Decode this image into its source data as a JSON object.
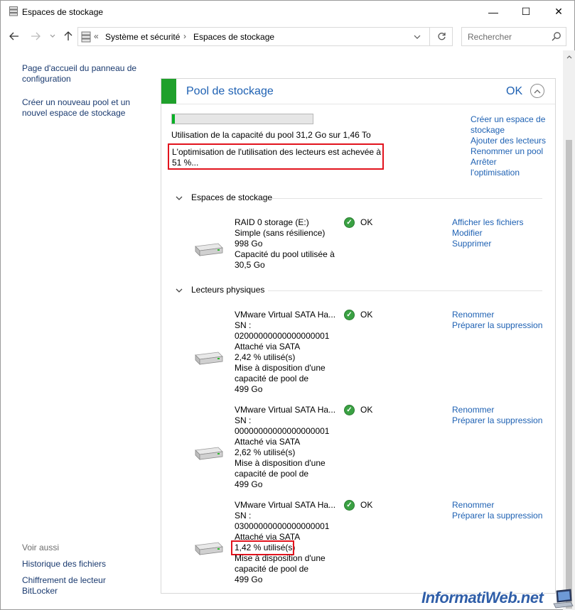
{
  "window": {
    "title": "Espaces de stockage",
    "min_glyph": "—",
    "max_glyph": "☐",
    "close_glyph": "✕"
  },
  "nav": {
    "breadcrumb_prefix": "«",
    "crumbs": [
      "Système et sécurité",
      "Espaces de stockage"
    ],
    "crumb_separator": "›",
    "search_placeholder": "Rechercher"
  },
  "left_pane": {
    "links": [
      "Page d'accueil du panneau de configuration",
      "Créer un nouveau pool et un nouvel espace de stockage"
    ],
    "see_also_label": "Voir aussi",
    "see_also_links": [
      "Historique des fichiers",
      "Chiffrement de lecteur BitLocker"
    ]
  },
  "pool": {
    "title": "Pool de stockage",
    "status": "OK",
    "capacity_used_fraction": 0.021,
    "capacity_usage": "Utilisation de la capacité du pool 31,2 Go sur 1,46 To",
    "optimization_status": "L'optimisation de l'utilisation des lecteurs est achevée à 51 %...",
    "actions": [
      "Créer un espace de stockage",
      "Ajouter des lecteurs",
      "Renommer un pool",
      "Arrêter l'optimisation"
    ]
  },
  "storage_spaces": {
    "heading": "Espaces de stockage",
    "items": [
      {
        "lines": [
          "RAID 0 storage (E:)",
          "Simple (sans résilience)",
          "998 Go",
          "Capacité du pool utilisée à",
          "30,5 Go"
        ],
        "status": "OK",
        "actions": [
          "Afficher les fichiers",
          "Modifier",
          "Supprimer"
        ]
      }
    ]
  },
  "physical_drives": {
    "heading": "Lecteurs physiques",
    "items": [
      {
        "lines": [
          "VMware Virtual SATA Ha...",
          "SN :",
          "02000000000000000001",
          "Attaché via SATA",
          "2,42 % utilisé(s)",
          "Mise à disposition d'une",
          "capacité de pool de",
          "499 Go"
        ],
        "status": "OK",
        "actions": [
          "Renommer",
          "Préparer la suppression"
        ]
      },
      {
        "lines": [
          "VMware Virtual SATA Ha...",
          "SN :",
          "00000000000000000001",
          "Attaché via SATA",
          "2,62 % utilisé(s)",
          "Mise à disposition d'une",
          "capacité de pool de",
          "499 Go"
        ],
        "status": "OK",
        "actions": [
          "Renommer",
          "Préparer la suppression"
        ]
      },
      {
        "lines": [
          "VMware Virtual SATA Ha...",
          "SN :",
          "03000000000000000001",
          "Attaché via SATA",
          "1,42 % utilisé(s)",
          "Mise à disposition d'une",
          "capacité de pool de",
          "499 Go"
        ],
        "status": "OK",
        "actions": [
          "Renommer",
          "Préparer la suppression"
        ]
      }
    ]
  },
  "watermark": "InformatiWeb.net",
  "colors": {
    "link": "#1e61b3",
    "pool_header_green": "#1fa02b",
    "progress_green": "#06b025",
    "highlight_red": "#e2131d",
    "ok_green": "#3aa143"
  }
}
